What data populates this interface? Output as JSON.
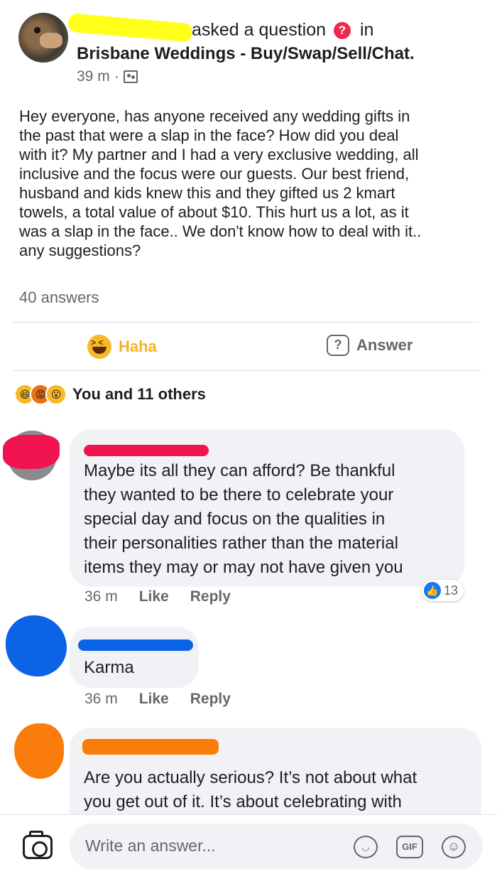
{
  "post": {
    "author_suffix": "asked a question",
    "in_label": "in",
    "question_icon_glyph": "?",
    "group_name": "Brisbane Weddings - Buy/Swap/Sell/Chat.",
    "time": "39 m",
    "meta_separator": "·",
    "body": "Hey everyone, has anyone received any wedding gifts in\nthe past that were a slap in the face? How did you deal\nwith it? My partner and I had a very exclusive wedding, all\ninclusive and the focus were our guests. Our best friend,\nhusband and kids knew this and they gifted us 2 kmart\ntowels, a total value of about $10. This hurt us a lot, as it\nwas a slap in the face.. We don't know how to deal with it..\nany suggestions?",
    "answers_count": "40 answers"
  },
  "actions": {
    "reaction_label": "Haha",
    "answer_label": "Answer",
    "answer_icon_glyph": "?"
  },
  "reactions": {
    "summary": "You and 11 others",
    "icons": [
      "haha-icon",
      "angry-icon",
      "wow-icon"
    ]
  },
  "comments": [
    {
      "text": "Maybe its all they can afford? Be thankful\nthey wanted to be there to celebrate your\nspecial day and focus on the qualities in\ntheir personalities rather than the material\nitems they may or may not have given you",
      "time": "36 m",
      "like_label": "Like",
      "reply_label": "Reply",
      "like_count": "13"
    },
    {
      "text": "Karma",
      "time": "36 m",
      "like_label": "Like",
      "reply_label": "Reply"
    },
    {
      "text": "Are you actually serious? It’s not about what\nyou get out of it. It’s about celebrating with"
    }
  ],
  "composer": {
    "placeholder": "Write an answer...",
    "gif_label": "GIF"
  },
  "colors": {
    "accent_blue": "#1877f2",
    "haha_yellow": "#f7b928",
    "redaction_yellow": "#ffff00",
    "redaction_pink": "#f0134f",
    "redaction_blue": "#0b63e5",
    "redaction_orange": "#fa7c0b"
  }
}
